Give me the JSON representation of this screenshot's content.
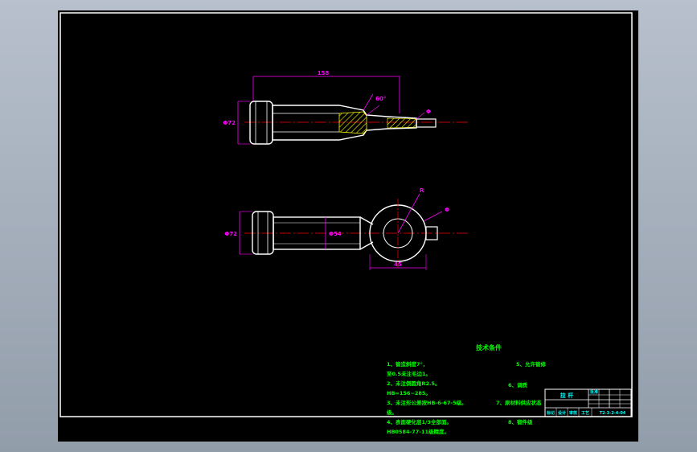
{
  "drawing": {
    "background": "#000000",
    "frame_color": "#ffffff",
    "part_color": "#ffffff",
    "dim_color": "#ff00ff",
    "center_color": "#ff0000",
    "note_color": "#00ff00",
    "title_color": "#00ffff",
    "hatch_color": "#ffff00",
    "top_view": {
      "overall_length_dim": "158",
      "head_dim": "Φ72",
      "angle_dim": "60°",
      "tip_dim": "Φ"
    },
    "bottom_view": {
      "head_dim": "Φ72",
      "shaft_dim": "Φ54",
      "radius_dim": "R",
      "ball_dim": "Φ",
      "bottom_dim": "45"
    },
    "notes": {
      "heading": "技术条件",
      "left_column": [
        "1、锻造斜度7°，",
        "至0.5未注毛边1。",
        "2、未注倒圆角R2.5。",
        "HB=156~285。",
        "3、未注形公差按HB-6-67-5级。",
        "级。",
        "4、表面硬化层1/3全部面。",
        "HB0584-77-11级精度。"
      ],
      "right_column": [
        "5、允许锻修",
        "6、调质",
        "7、原材料供应状态",
        "8、锻件级"
      ]
    },
    "title_block": {
      "name_cell": "拉 杆",
      "drawing_number": "T2-3-2-4-04",
      "small_rows": [
        "标记",
        "设计",
        "审核",
        "工艺",
        "批准"
      ]
    }
  }
}
